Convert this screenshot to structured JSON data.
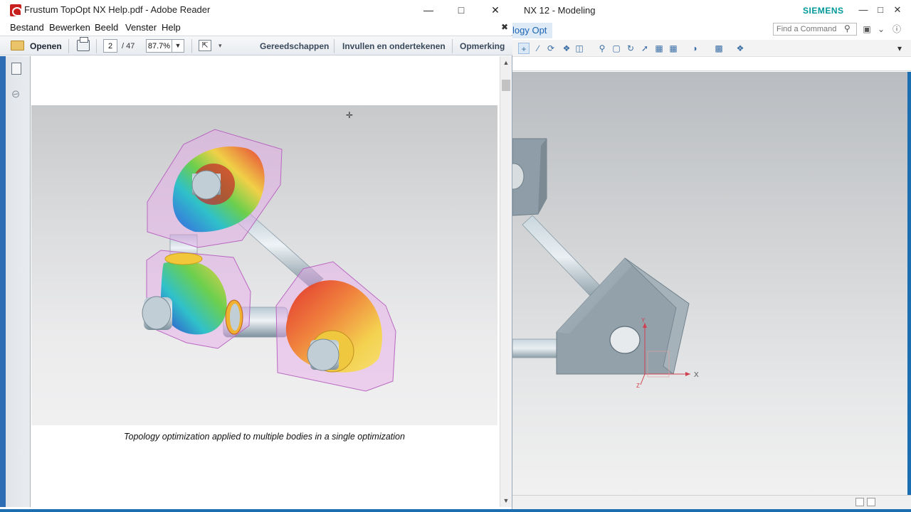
{
  "nx": {
    "title": "NX 12 - Modeling",
    "brand": "SIEMENS",
    "tab_label": "logy Opt",
    "find_command_placeholder": "Find a Command",
    "axis_x_label": "X",
    "axis_y_label": "Y",
    "axis_z_label": "Z"
  },
  "reader": {
    "title": "Frustum TopOpt NX Help.pdf - Adobe Reader",
    "menu": [
      "Bestand",
      "Bewerken",
      "Beeld",
      "Venster",
      "Help"
    ],
    "toolbar": {
      "open_label": "Openen",
      "current_page": "2",
      "total_pages": "/ 47",
      "zoom": "87.7%"
    },
    "panes": [
      "Gereedschappen",
      "Invullen en ondertekenen",
      "Opmerking"
    ],
    "caption": "Topology optimization applied to multiple bodies in a single optimization"
  },
  "colors": {
    "accent": "#1a64b4",
    "siemens": "#009999",
    "adobe_red": "#c8201f",
    "desktop_blue": "#1b6fb0"
  }
}
